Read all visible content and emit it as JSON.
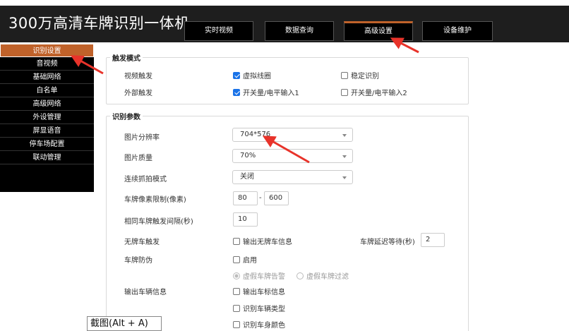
{
  "header": {
    "title": "300万高清车牌识别一体机",
    "tabs": [
      {
        "label": "实时视频"
      },
      {
        "label": "数据查询"
      },
      {
        "label": "高级设置",
        "active": true
      },
      {
        "label": "设备维护"
      }
    ]
  },
  "sidebar": {
    "items": [
      {
        "label": "识别设置",
        "active": true
      },
      {
        "label": "音视频"
      },
      {
        "label": "基础网络"
      },
      {
        "label": "白名单"
      },
      {
        "label": "高级网络"
      },
      {
        "label": "外设管理"
      },
      {
        "label": "屏显语音"
      },
      {
        "label": "停车场配置"
      },
      {
        "label": "联动管理"
      }
    ]
  },
  "trigger_mode": {
    "legend": "触发模式",
    "video_trigger": {
      "label": "视频触发",
      "options": [
        {
          "label": "虚拟线圈",
          "checked": true
        },
        {
          "label": "稳定识别",
          "checked": false
        }
      ]
    },
    "external_trigger": {
      "label": "外部触发",
      "options": [
        {
          "label": "开关量/电平输入1",
          "checked": true
        },
        {
          "label": "开关量/电平输入2",
          "checked": false
        }
      ]
    }
  },
  "recognition_params": {
    "legend": "识别参数",
    "resolution": {
      "label": "图片分辨率",
      "value": "704*576"
    },
    "quality": {
      "label": "图片质量",
      "value": "70%"
    },
    "burst_mode": {
      "label": "连续抓拍模式",
      "value": "关闭"
    },
    "plate_pixel_limit": {
      "label": "车牌像素限制(像素)",
      "min": "80",
      "separator": "-",
      "max": "600"
    },
    "same_plate_interval": {
      "label": "相同车牌触发间隔(秒)",
      "value": "10"
    },
    "no_plate_trigger": {
      "label": "无牌车触发",
      "option": {
        "label": "输出无牌车信息",
        "checked": false
      },
      "delay_label": "车牌延迟等待(秒)",
      "delay_value": "2"
    },
    "anti_fake": {
      "label": "车牌防伪",
      "enable": {
        "label": "启用",
        "checked": false
      },
      "radio_alarm": {
        "label": "虚假车牌告警",
        "selected": true
      },
      "radio_filter": {
        "label": "虚假车牌过滤",
        "selected": false
      }
    },
    "vehicle_info": {
      "label": "输出车辆信息",
      "options": [
        {
          "label": "输出车标信息",
          "checked": false
        },
        {
          "label": "识别车辆类型",
          "checked": false
        },
        {
          "label": "识别车身颜色",
          "checked": false
        }
      ]
    }
  },
  "tooltip": {
    "text": "截图(Alt + A)"
  },
  "colors": {
    "accent": "#c0622a",
    "header_bg": "#1e1e1e",
    "arrow": "#e8332a",
    "check": "#1a73e8"
  }
}
